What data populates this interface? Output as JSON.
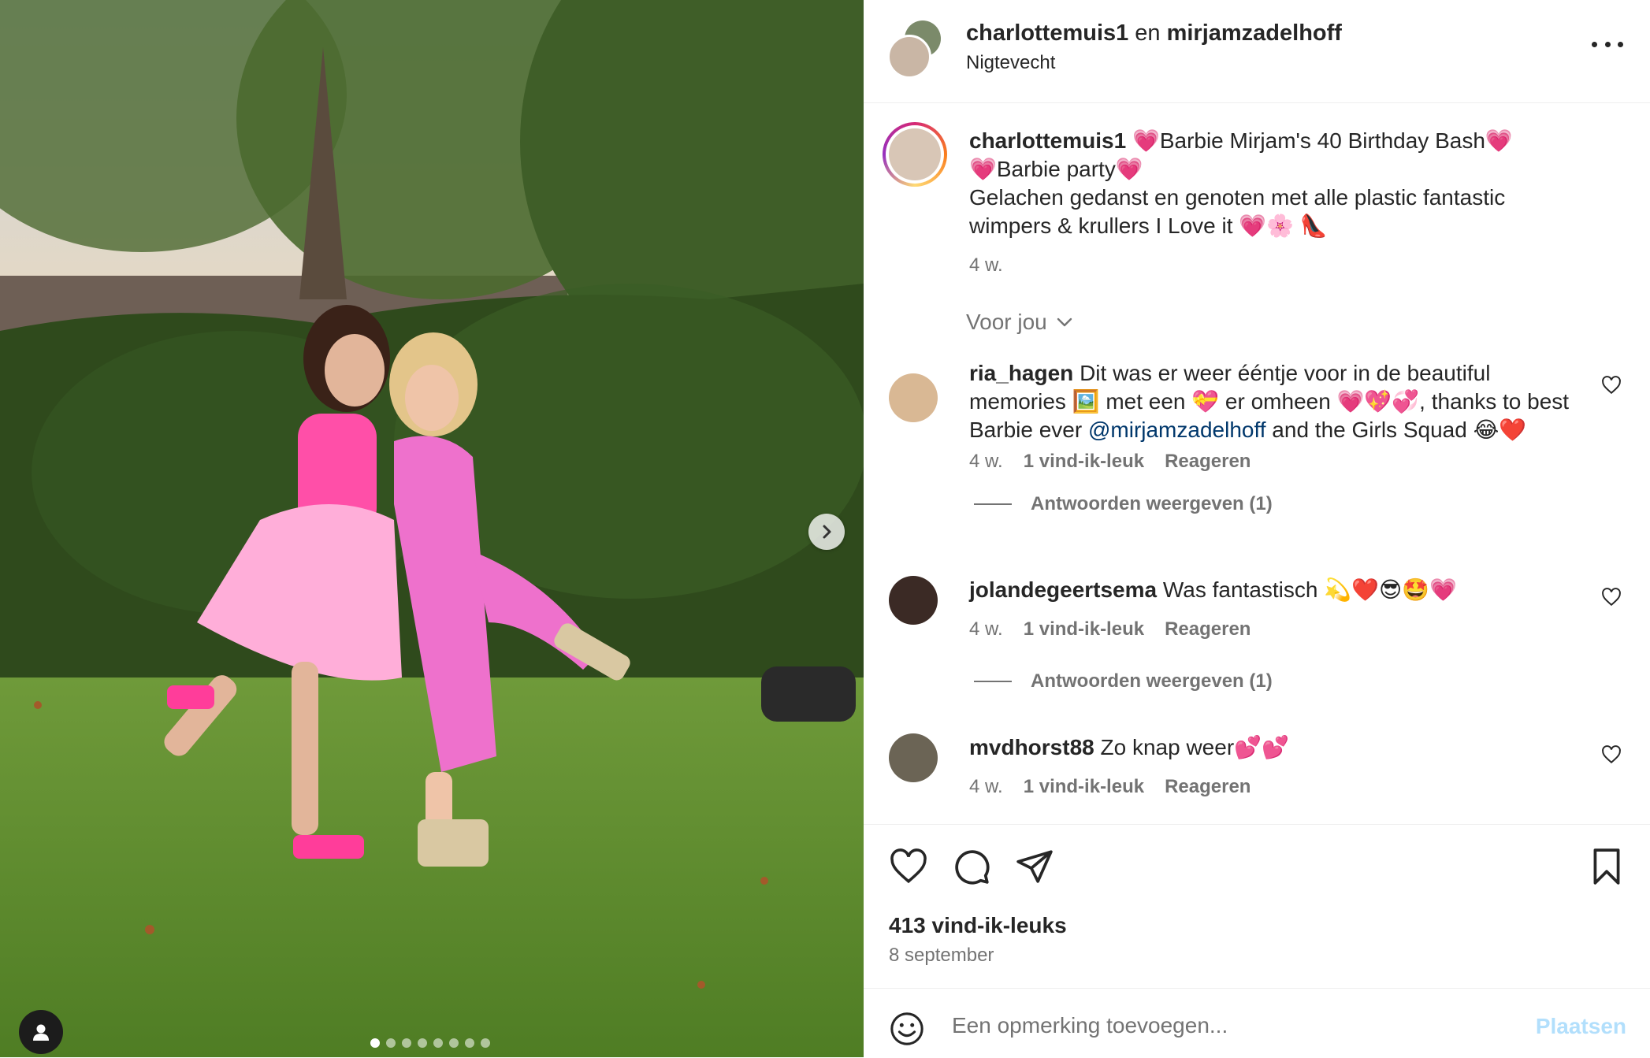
{
  "photo": {
    "alt_scene": "",
    "carousel_count": 8,
    "carousel_active": 0,
    "next_icon": "chevron-right-icon",
    "tag_icon": "user-tag-icon"
  },
  "header": {
    "user1": "charlottemuis1",
    "conjunction": "en",
    "user2": "mirjamzadelhoff",
    "location": "Nigtevecht",
    "more_icon": "more-options-icon"
  },
  "caption": {
    "username": "charlottemuis1",
    "line1": "💗Barbie Mirjam's 40 Birthday Bash💗",
    "line2": "💗Barbie party💗",
    "line3": "Gelachen gedanst en genoten met alle plastic fantastic",
    "line4": "wimpers & krullers I Love it 💗🌸 👠",
    "time": "4 w."
  },
  "voor_jou": "Voor jou",
  "comments": [
    {
      "username": "ria_hagen",
      "text_before": "Dit was er weer ééntje voor in de beautiful memories 🖼️ met een 💝 er omheen 💗💖💞, thanks to best Barbie ever ",
      "mention": "@mirjamzadelhoff",
      "text_after": " and the Girls Squad 😂❤️",
      "time": "4 w.",
      "likes": "1 vind-ik-leuk",
      "reply": "Reageren",
      "view_replies": "Antwoorden weergeven (1)"
    },
    {
      "username": "jolandegeertsema",
      "text_before": "Was fantastisch 💫❤️😎🤩💗",
      "time": "4 w.",
      "likes": "1 vind-ik-leuk",
      "reply": "Reageren",
      "view_replies": "Antwoorden weergeven (1)"
    },
    {
      "username": "mvdhorst88",
      "text_before": "Zo knap weer💕💕",
      "time": "4 w.",
      "likes": "1 vind-ik-leuk",
      "reply": "Reageren"
    }
  ],
  "actions": {
    "like_icon": "heart-icon",
    "comment_icon": "comment-icon",
    "share_icon": "send-icon",
    "save_icon": "bookmark-icon",
    "likes_count": "413 vind-ik-leuks",
    "date": "8 september"
  },
  "add_comment": {
    "placeholder": "Een opmerking toevoegen...",
    "post_label": "Plaatsen",
    "emoji_icon": "emoji-icon"
  },
  "colors": {
    "accent_link": "#00376b",
    "post_disabled": "#b2dffc",
    "secondary_text": "#737373"
  }
}
